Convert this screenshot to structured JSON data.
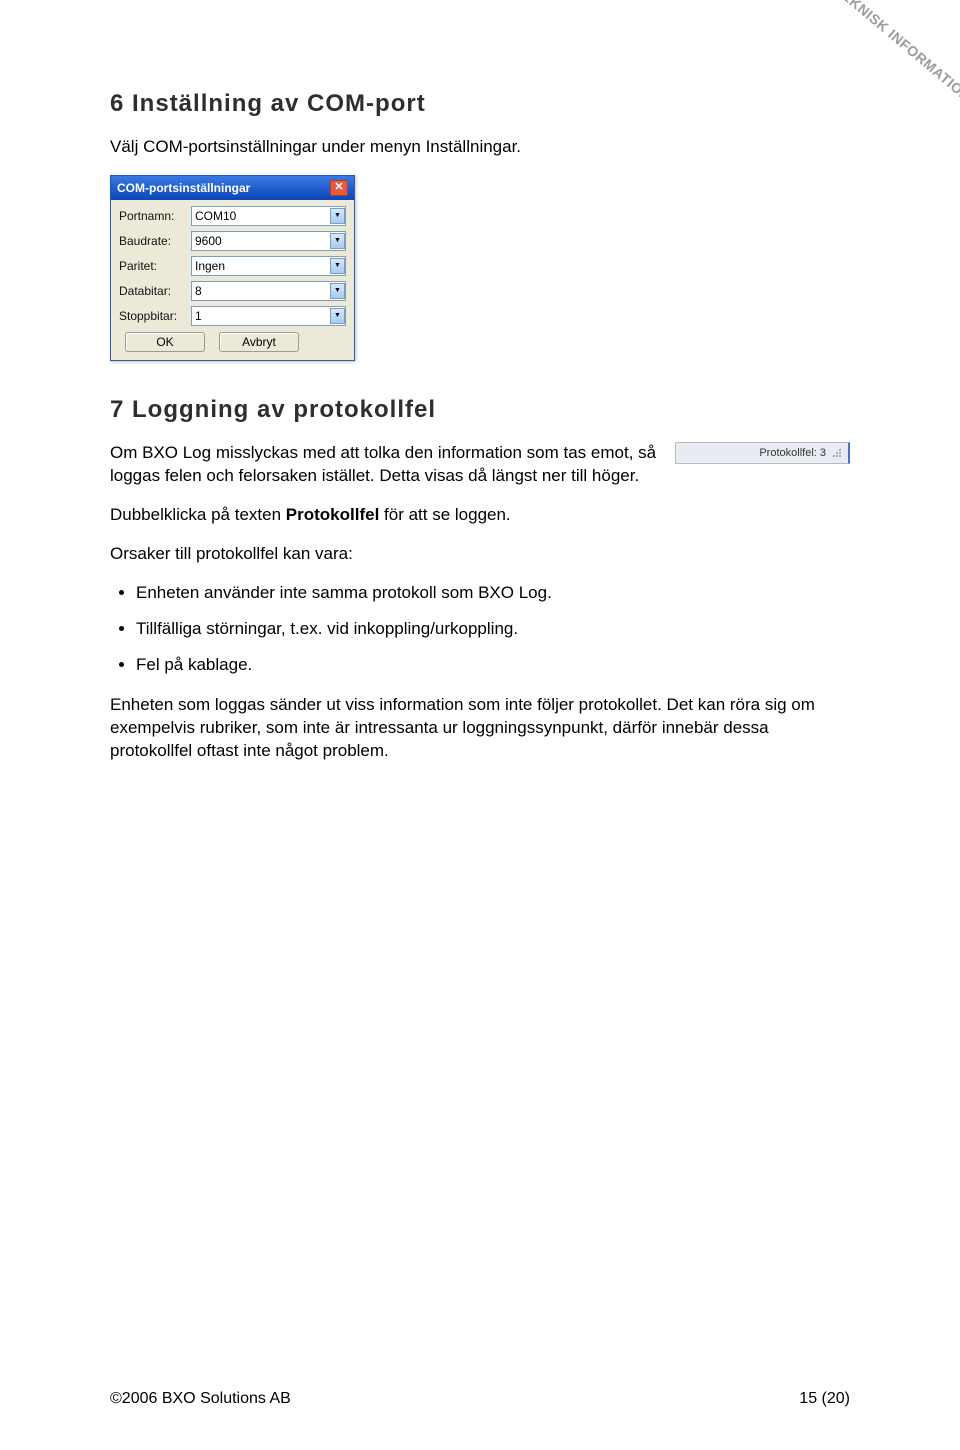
{
  "watermark": "TEKNISK INFORMATION",
  "section6": {
    "heading": "6  Inställning av COM-port",
    "intro": "Välj COM-portsinställningar under menyn Inställningar."
  },
  "dialog": {
    "title": "COM-portsinställningar",
    "fields": {
      "portnamn": {
        "label": "Portnamn:",
        "value": "COM10"
      },
      "baudrate": {
        "label": "Baudrate:",
        "value": "9600"
      },
      "paritet": {
        "label": "Paritet:",
        "value": "Ingen"
      },
      "databitar": {
        "label": "Databitar:",
        "value": "8"
      },
      "stoppbitar": {
        "label": "Stoppbitar:",
        "value": "1"
      }
    },
    "ok": "OK",
    "cancel": "Avbryt"
  },
  "section7": {
    "heading": "7  Loggning av protokollfel",
    "statusbar": "Protokollfel: 3",
    "p1": "Om BXO Log misslyckas med att tolka den information som tas emot, så loggas felen och felorsaken istället. Detta visas då längst ner till höger.",
    "p2_pre": "Dubbelklicka på texten ",
    "p2_bold": "Protokollfel",
    "p2_post": " för att se loggen.",
    "p3": "Orsaker till protokollfel kan vara:",
    "bullets": [
      "Enheten använder inte samma protokoll som BXO Log.",
      "Tillfälliga störningar, t.ex. vid inkoppling/urkoppling.",
      "Fel på kablage."
    ],
    "p4": "Enheten som loggas sänder ut viss information som inte följer protokollet. Det kan röra sig om exempelvis rubriker, som inte är intressanta ur loggningssynpunkt, därför innebär dessa protokollfel oftast inte något problem."
  },
  "footer": {
    "left": "©2006 BXO Solutions AB",
    "right": "15 (20)"
  }
}
